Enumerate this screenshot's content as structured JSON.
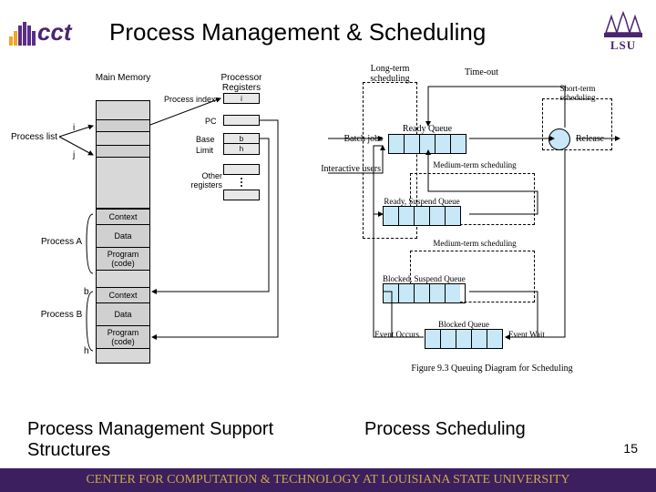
{
  "header": {
    "title": "Process Management & Scheduling",
    "cct_text": "cct",
    "lsu_text": "LSU"
  },
  "left": {
    "main_memory": "Main Memory",
    "processor_registers": "Processor Registers",
    "process_index": "Process index",
    "pc": "PC",
    "base": "Base",
    "limit": "Limit",
    "other_registers": "Other registers",
    "process_list": "Process list",
    "i": "i",
    "j": "j",
    "b": "b",
    "h": "h",
    "reg_i": "i",
    "reg_b": "b",
    "reg_h": "h",
    "process_a": "Process A",
    "process_b": "Process B",
    "context": "Context",
    "data": "Data",
    "program": "Program (code)"
  },
  "right": {
    "long_term": "Long-term scheduling",
    "timeout": "Time-out",
    "short_term": "Short-term scheduling",
    "batch_jobs": "Batch jobs",
    "ready_queue": "Ready Queue",
    "release": "Release",
    "interactive_users": "Interactive users",
    "medium_term": "Medium-term scheduling",
    "ready_suspend": "Ready, Suspend Queue",
    "blocked_suspend": "Blocked, Suspend Queue",
    "blocked_queue": "Blocked Queue",
    "event_occurs": "Event Occurs",
    "event_wait": "Event Wait",
    "figure_caption": "Figure 9.3  Queuing Diagram for Scheduling"
  },
  "captions": {
    "left": "Process Management Support Structures",
    "right": "Process Scheduling"
  },
  "footer": "CENTER FOR COMPUTATION & TECHNOLOGY AT LOUISIANA STATE UNIVERSITY",
  "page": "15"
}
